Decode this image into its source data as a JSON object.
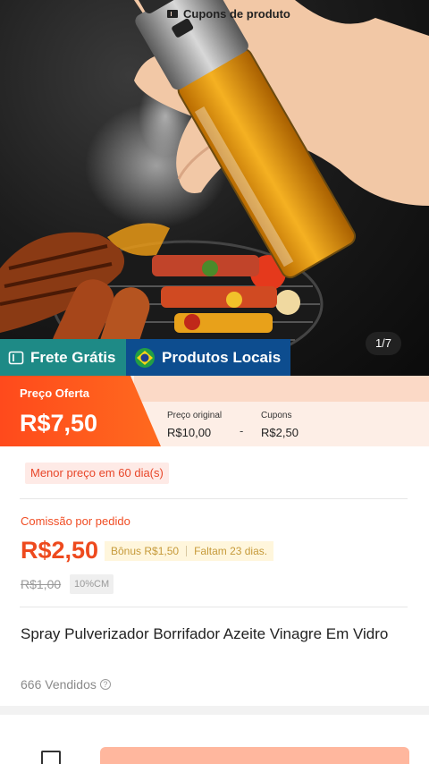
{
  "gallery": {
    "counter": "1/7"
  },
  "badges": {
    "frete": "Frete Grátis",
    "locais": "Produtos Locais"
  },
  "price": {
    "oferta_label": "Preço Oferta",
    "oferta_value": "R$7,50",
    "cupons_title": "Cupons de produto",
    "original_label": "Preço original",
    "original_value": "R$10,00",
    "minus": "-",
    "cupons_label": "Cupons",
    "cupons_value": "R$2,50"
  },
  "info": {
    "menor_preco": "Menor preço em 60 dia(s)",
    "comissao_label": "Comissão por pedido",
    "comissao_value": "R$2,50",
    "bonus": "Bônus R$1,50",
    "faltam": "Faltam 23 dias.",
    "old_commission": "R$1,00",
    "cm_tag": "10%CM",
    "product_title": "Spray Pulverizador Borrifador Azeite Vinagre Em Vidro",
    "sold": "666 Vendidos"
  },
  "colors": {
    "accent": "#ff4a1c",
    "frete": "#1e8a86",
    "locais": "#0d4d8f",
    "cta": "#ffb79e"
  }
}
